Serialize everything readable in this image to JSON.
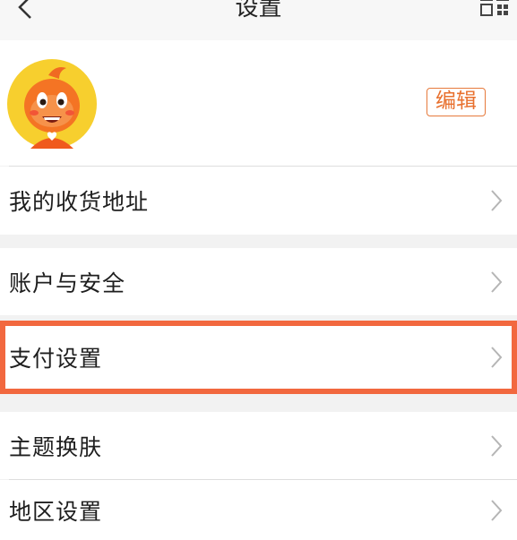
{
  "header": {
    "title": "设置",
    "back_icon": "chevron-left-icon",
    "qr_icon": "qr-code-icon"
  },
  "profile": {
    "avatar": "cartoon-mascot-avatar",
    "edit_label": "编辑"
  },
  "menu": {
    "items": [
      {
        "label": "我的收货地址"
      },
      {
        "label": "账户与安全"
      },
      {
        "label": "支付设置"
      },
      {
        "label": "主题换肤"
      },
      {
        "label": "地区设置"
      }
    ]
  },
  "colors": {
    "accent": "#e8702e",
    "highlight": "#f2683f",
    "chevron": "#b5b5b5"
  }
}
